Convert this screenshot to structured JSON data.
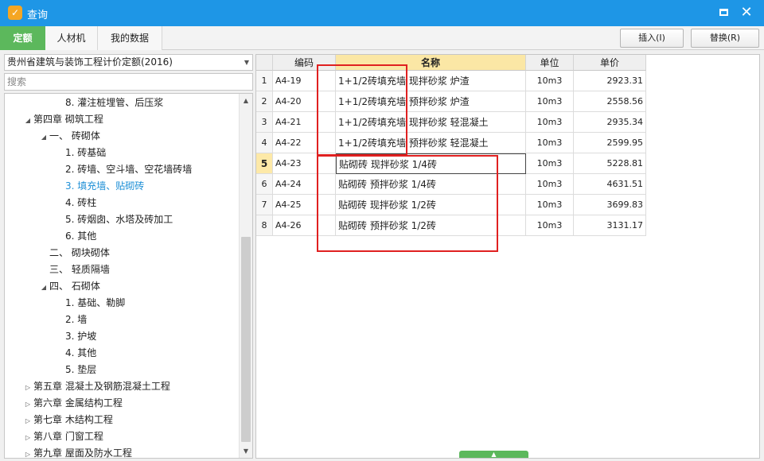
{
  "window": {
    "title": "查询",
    "app_icon": "app-logo-icon",
    "maximize_icon": "maximize-icon",
    "close_glyph": "✕"
  },
  "tabs": [
    {
      "label": "定额",
      "active": true
    },
    {
      "label": "人材机",
      "active": false
    },
    {
      "label": "我的数据",
      "active": false
    }
  ],
  "toolbar": {
    "insert_label": "插入(I)",
    "replace_label": "替换(R)"
  },
  "library_select": {
    "value": "贵州省建筑与装饰工程计价定额(2016)"
  },
  "search": {
    "placeholder": "搜索",
    "value": ""
  },
  "tree": {
    "rows": [
      {
        "label": "8. 灌注桩埋管、后压浆",
        "toggle": "",
        "selected": false
      },
      {
        "label": "第四章 砌筑工程",
        "toggle": "◢",
        "selected": false
      },
      {
        "label": "一、 砖砌体",
        "toggle": "◢",
        "selected": false
      },
      {
        "label": "1. 砖基础",
        "toggle": "",
        "selected": false
      },
      {
        "label": "2. 砖墙、空斗墙、空花墙砖墙",
        "toggle": "",
        "selected": false
      },
      {
        "label": "3. 填充墙、贴砌砖",
        "toggle": "",
        "selected": true
      },
      {
        "label": "4. 砖柱",
        "toggle": "",
        "selected": false
      },
      {
        "label": "5. 砖烟囱、水塔及砖加工",
        "toggle": "",
        "selected": false
      },
      {
        "label": "6. 其他",
        "toggle": "",
        "selected": false
      },
      {
        "label": "二、 砌块砌体",
        "toggle": "",
        "selected": false
      },
      {
        "label": "三、 轻质隔墙",
        "toggle": "",
        "selected": false
      },
      {
        "label": "四、 石砌体",
        "toggle": "◢",
        "selected": false
      },
      {
        "label": "1. 基础、勒脚",
        "toggle": "",
        "selected": false
      },
      {
        "label": "2. 墙",
        "toggle": "",
        "selected": false
      },
      {
        "label": "3. 护坡",
        "toggle": "",
        "selected": false
      },
      {
        "label": "4. 其他",
        "toggle": "",
        "selected": false
      },
      {
        "label": "5. 垫层",
        "toggle": "",
        "selected": false
      },
      {
        "label": "第五章 混凝土及钢筋混凝土工程",
        "toggle": "▷",
        "selected": false
      },
      {
        "label": "第六章 金属结构工程",
        "toggle": "▷",
        "selected": false
      },
      {
        "label": "第七章 木结构工程",
        "toggle": "▷",
        "selected": false
      },
      {
        "label": "第八章 门窗工程",
        "toggle": "▷",
        "selected": false
      },
      {
        "label": "第九章 屋面及防水工程",
        "toggle": "▷",
        "selected": false
      }
    ]
  },
  "grid": {
    "headers": {
      "code": "编码",
      "name": "名称",
      "unit": "单位",
      "price": "单价"
    },
    "rows": [
      {
        "no": "1",
        "code": "A4-19",
        "name": "1+1/2砖填充墙 现拌砂浆 炉渣",
        "unit": "10m3",
        "price": "2923.31"
      },
      {
        "no": "2",
        "code": "A4-20",
        "name": "1+1/2砖填充墙 预拌砂浆 炉渣",
        "unit": "10m3",
        "price": "2558.56"
      },
      {
        "no": "3",
        "code": "A4-21",
        "name": "1+1/2砖填充墙 现拌砂浆 轻混凝土",
        "unit": "10m3",
        "price": "2935.34"
      },
      {
        "no": "4",
        "code": "A4-22",
        "name": "1+1/2砖填充墙 预拌砂浆 轻混凝土",
        "unit": "10m3",
        "price": "2599.95"
      },
      {
        "no": "5",
        "code": "A4-23",
        "name": "贴砌砖 现拌砂浆 1/4砖",
        "unit": "10m3",
        "price": "5228.81"
      },
      {
        "no": "6",
        "code": "A4-24",
        "name": "贴砌砖 预拌砂浆 1/4砖",
        "unit": "10m3",
        "price": "4631.51"
      },
      {
        "no": "7",
        "code": "A4-25",
        "name": "贴砌砖 现拌砂浆 1/2砖",
        "unit": "10m3",
        "price": "3699.83"
      },
      {
        "no": "8",
        "code": "A4-26",
        "name": "贴砌砖 预拌砂浆 1/2砖",
        "unit": "10m3",
        "price": "3131.17"
      }
    ]
  },
  "colors": {
    "titlebar": "#1e96e6",
    "active_tab": "#5cb85c",
    "name_header": "#fbe7a5",
    "selected_tree": "#1e8fd6",
    "annotation": "#e02020"
  }
}
